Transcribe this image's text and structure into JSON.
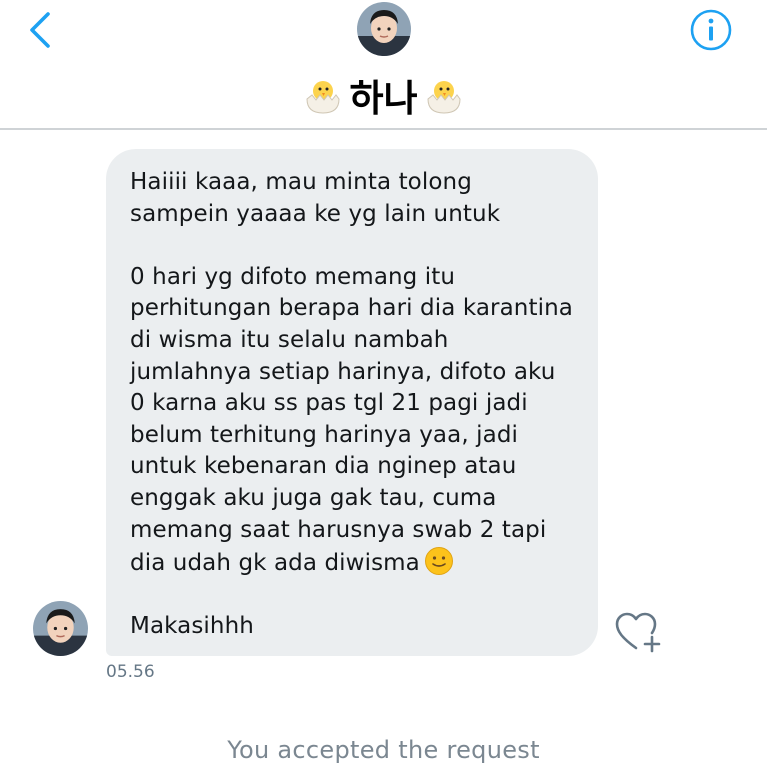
{
  "header": {
    "title": "하나",
    "title_icon": "hatching-chick-icon",
    "back_icon": "chevron-left-icon",
    "info_icon": "info-icon",
    "avatar": "user-avatar"
  },
  "message": {
    "text": "Haiiii kaaa, mau minta tolong sampein yaaaa ke yg lain untuk\n\n0 hari yg difoto memang itu perhitungan berapa hari dia karantina di wisma itu selalu nambah jumlahnya setiap harinya, difoto aku 0 karna aku ss pas tgl 21 pagi jadi belum terhitung harinya yaa, jadi untuk kebenaran dia nginep atau enggak aku juga gak tau, cuma memang saat harusnya swab 2 tapi dia udah gk ada diwisma",
    "emoji": "slightly-smiling-face-icon",
    "closing": "Makasihhh",
    "timestamp": "05.56",
    "like_icon": "heart-plus-icon"
  },
  "status": {
    "text": "You accepted the request"
  },
  "colors": {
    "accent": "#1da1f2",
    "bubble": "#ebeef0",
    "divider": "#cfd3d6",
    "text": "#14171a",
    "muted": "#657786"
  }
}
